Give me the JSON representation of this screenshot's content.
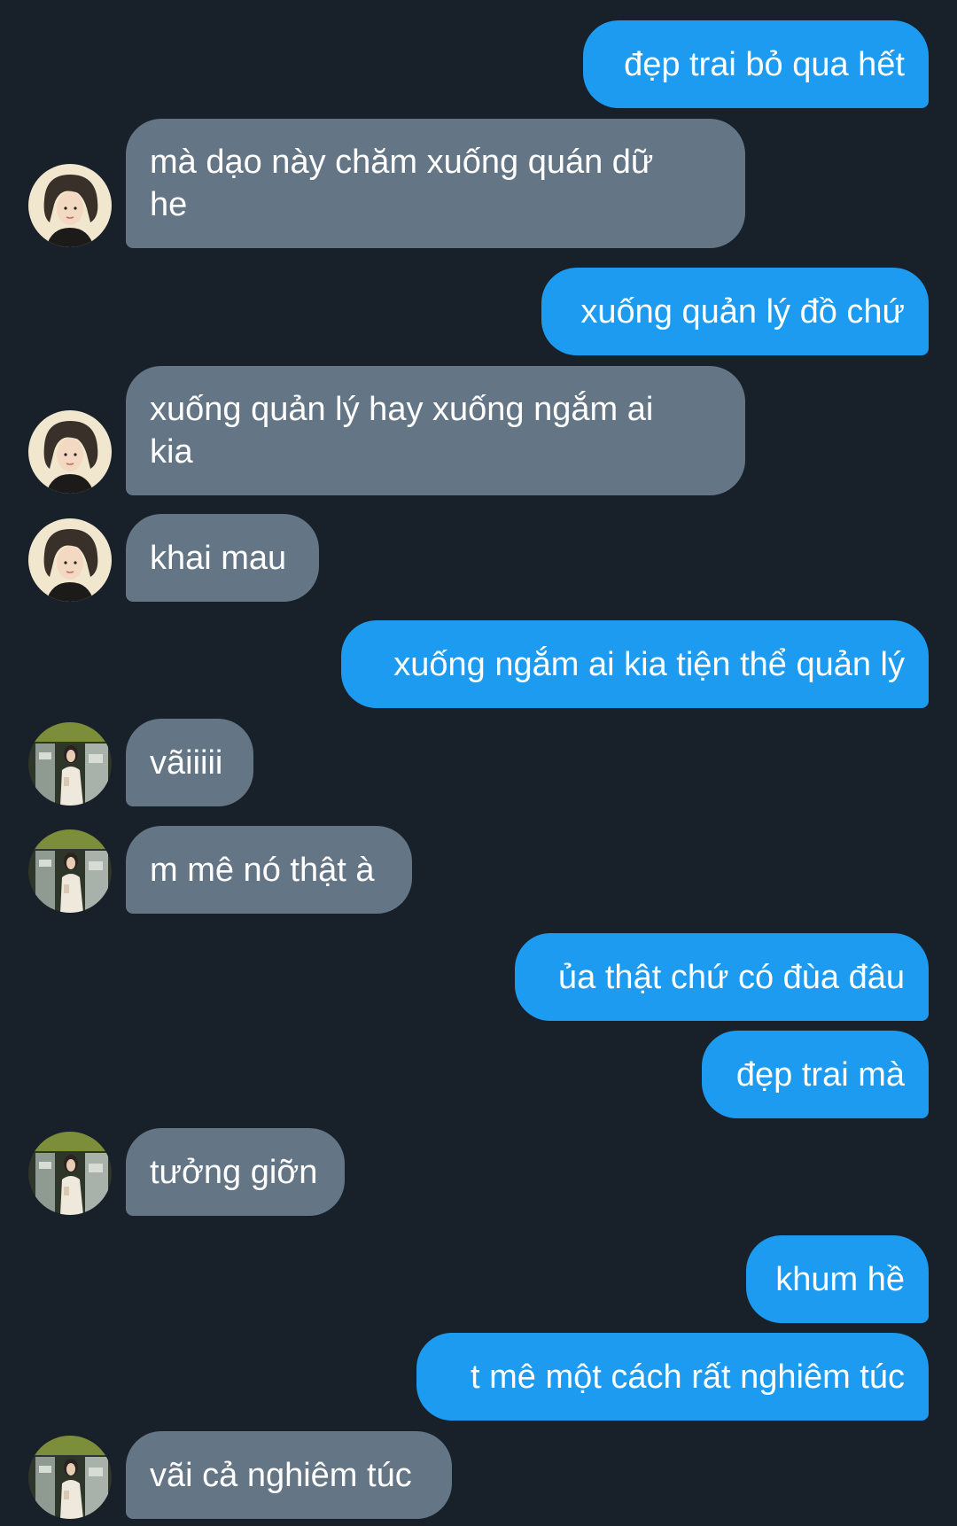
{
  "messages": [
    {
      "side": "out",
      "text": "đẹp trai bỏ qua hết"
    },
    {
      "side": "in",
      "text": "mà dạo này chăm xuống quán dữ he"
    },
    {
      "side": "out",
      "text": "xuống quản lý đồ chứ"
    },
    {
      "side": "in",
      "text": "xuống quản lý hay xuống ngắm ai kia"
    },
    {
      "side": "in",
      "text": "khai mau"
    },
    {
      "side": "out",
      "text": "xuống ngắm ai kia tiện thể quản lý"
    },
    {
      "side": "in",
      "text": "vãiiiii"
    },
    {
      "side": "in",
      "text": "m mê nó thật à"
    },
    {
      "side": "out",
      "text": "ủa thật chứ có đùa đâu"
    },
    {
      "side": "out",
      "text": "đẹp trai mà"
    },
    {
      "side": "in",
      "text": "tưởng giỡn"
    },
    {
      "side": "out",
      "text": "khum hề"
    },
    {
      "side": "out",
      "text": "t mê một cách rất nghiêm túc"
    },
    {
      "side": "in",
      "text": "vãi cả nghiêm túc"
    }
  ],
  "colors": {
    "background": "#18202a",
    "outgoing_bubble": "#1d9bf0",
    "incoming_bubble": "#647586",
    "text": "#ffffff"
  },
  "avatars": {
    "friend_a": "avatar-portrait-icon",
    "friend_b": "avatar-photo-icon"
  }
}
